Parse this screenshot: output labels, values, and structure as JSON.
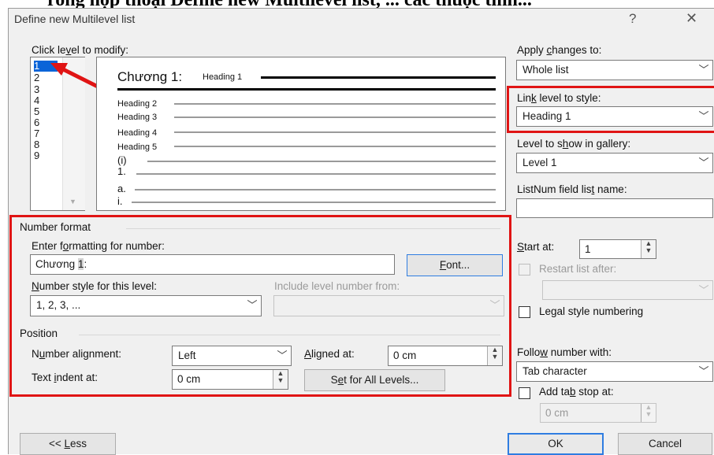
{
  "caption_partial": "rong hộp thoại Define new Multilevel list, ... các thuộc tính...",
  "dialog": {
    "title": "Define new Multilevel list",
    "help": "?",
    "close": "✕"
  },
  "levels": {
    "label": "Click level to modify:",
    "items": [
      "1",
      "2",
      "3",
      "4",
      "5",
      "6",
      "7",
      "8",
      "9"
    ],
    "selected": "1"
  },
  "preview": {
    "level1_prefix": "Chương 1:",
    "level1_heading": "Heading 1",
    "rows": [
      "Heading 2",
      "Heading 3",
      "Heading 4",
      "Heading 5",
      "(i)",
      "1.",
      "a.",
      "i."
    ]
  },
  "number_format": {
    "section": "Number format",
    "enter_label": "Enter formatting for number:",
    "format_value": "Chương ",
    "format_highlight": "1",
    "format_suffix": ":",
    "font_button": "Font...",
    "style_label": "Number style for this level:",
    "style_value": "1, 2, 3, ...",
    "include_label": "Include level number from:",
    "include_value": ""
  },
  "position": {
    "section": "Position",
    "alignment_label": "Number alignment:",
    "alignment_value": "Left",
    "aligned_at_label": "Aligned at:",
    "aligned_at_value": "0 cm",
    "indent_label": "Text indent at:",
    "indent_value": "0 cm",
    "set_all_button": "Set for All Levels..."
  },
  "right": {
    "apply_label": "Apply changes to:",
    "apply_value": "Whole list",
    "link_label": "Link level to style:",
    "link_value": "Heading 1",
    "gallery_label": "Level to show in gallery:",
    "gallery_value": "Level 1",
    "listnum_label": "ListNum field list name:",
    "listnum_value": "",
    "start_label": "Start at:",
    "start_value": "1",
    "restart_label": "Restart list after:",
    "restart_value": "",
    "legal_label": "Legal style numbering",
    "follow_label": "Follow number with:",
    "follow_value": "Tab character",
    "tabstop_label": "Add tab stop at:",
    "tabstop_value": "0 cm"
  },
  "buttons": {
    "less": "<< Less",
    "ok": "OK",
    "cancel": "Cancel"
  },
  "colors": {
    "highlight_border": "#e01414",
    "selection": "#0a64d8",
    "default_button": "#2f7de1"
  }
}
